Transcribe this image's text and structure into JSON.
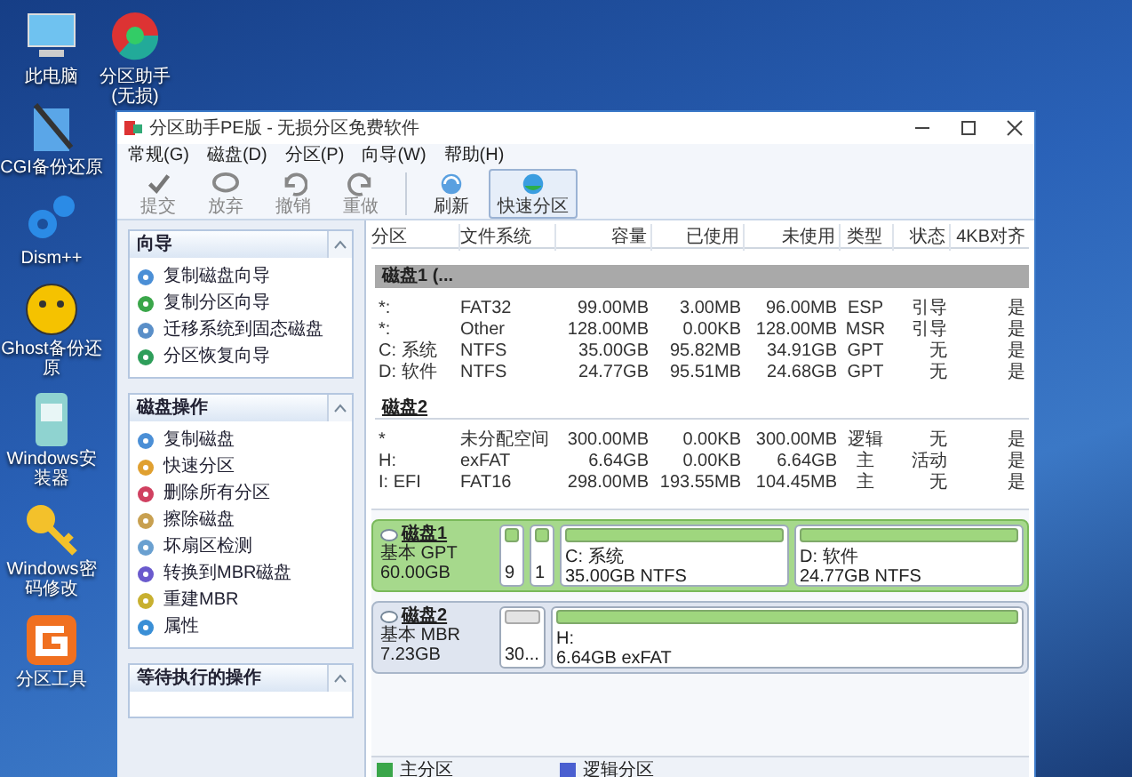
{
  "desktop_icons": [
    {
      "label": "此电脑",
      "kind": "computer"
    },
    {
      "label": "CGI备份还原",
      "kind": "tools"
    },
    {
      "label": "Dism++",
      "kind": "gears"
    },
    {
      "label": "Ghost备份还原",
      "kind": "ghost"
    },
    {
      "label": "Windows安装器",
      "kind": "installer"
    },
    {
      "label": "Windows密码修改",
      "kind": "key"
    },
    {
      "label": "分区工具",
      "kind": "diskgenius"
    }
  ],
  "desktop_icon_extra": {
    "label": "分区助手(无损)",
    "kind": "pie"
  },
  "window": {
    "title": "分区助手PE版 - 无损分区免费软件"
  },
  "menu": [
    "常规(G)",
    "磁盘(D)",
    "分区(P)",
    "向导(W)",
    "帮助(H)"
  ],
  "toolbar": [
    {
      "label": "提交",
      "kind": "check",
      "disabled": true,
      "selected": false
    },
    {
      "label": "放弃",
      "kind": "discard",
      "disabled": true,
      "selected": false
    },
    {
      "label": "撤销",
      "kind": "undo",
      "disabled": true,
      "selected": false
    },
    {
      "label": "重做",
      "kind": "redo",
      "disabled": true,
      "selected": false
    },
    {
      "label": "刷新",
      "kind": "refresh",
      "disabled": false,
      "selected": false
    },
    {
      "label": "快速分区",
      "kind": "quick",
      "disabled": false,
      "selected": true
    }
  ],
  "sidebar": [
    {
      "title": "向导",
      "items": [
        {
          "label": "复制磁盘向导",
          "kind": "disk"
        },
        {
          "label": "复制分区向导",
          "kind": "partition"
        },
        {
          "label": "迁移系统到固态磁盘",
          "kind": "migrate"
        },
        {
          "label": "分区恢复向导",
          "kind": "recover"
        }
      ]
    },
    {
      "title": "磁盘操作",
      "items": [
        {
          "label": "复制磁盘",
          "kind": "disk"
        },
        {
          "label": "快速分区",
          "kind": "quick"
        },
        {
          "label": "删除所有分区",
          "kind": "delete"
        },
        {
          "label": "擦除磁盘",
          "kind": "wipe"
        },
        {
          "label": "坏扇区检测",
          "kind": "scan"
        },
        {
          "label": "转换到MBR磁盘",
          "kind": "convert"
        },
        {
          "label": "重建MBR",
          "kind": "rebuild"
        },
        {
          "label": "属性",
          "kind": "info"
        }
      ]
    },
    {
      "title": "等待执行的操作"
    }
  ],
  "table": {
    "columns": [
      "分区",
      "文件系统",
      "容量",
      "已使用",
      "未使用",
      "类型",
      "状态",
      "4KB对齐"
    ],
    "disks": [
      {
        "header": "磁盘1 (...",
        "selected": true,
        "rows": [
          [
            "*:",
            "FAT32",
            "99.00MB",
            "3.00MB",
            "96.00MB",
            "ESP",
            "引导",
            "是"
          ],
          [
            "*:",
            "Other",
            "128.00MB",
            "0.00KB",
            "128.00MB",
            "MSR",
            "引导",
            "是"
          ],
          [
            "C: 系统",
            "NTFS",
            "35.00GB",
            "95.82MB",
            "34.91GB",
            "GPT",
            "无",
            "是"
          ],
          [
            "D: 软件",
            "NTFS",
            "24.77GB",
            "95.51MB",
            "24.68GB",
            "GPT",
            "无",
            "是"
          ]
        ]
      },
      {
        "header": "磁盘2",
        "selected": false,
        "rows": [
          [
            "*",
            "未分配空间",
            "300.00MB",
            "0.00KB",
            "300.00MB",
            "逻辑",
            "无",
            "是"
          ],
          [
            "H:",
            "exFAT",
            "6.64GB",
            "0.00KB",
            "6.64GB",
            "主",
            "活动",
            "是"
          ],
          [
            "I: EFI",
            "FAT16",
            "298.00MB",
            "193.55MB",
            "104.45MB",
            "主",
            "无",
            "是"
          ]
        ]
      }
    ]
  },
  "disk_map": [
    {
      "name": "磁盘1",
      "type": "基本 GPT",
      "size": "60.00GB",
      "selected": true,
      "partitions": [
        {
          "kind": "small",
          "label": "9"
        },
        {
          "kind": "small",
          "label": "1"
        },
        {
          "kind": "primary",
          "label": "C: 系统",
          "detail": "35.00GB NTFS"
        },
        {
          "kind": "primary",
          "label": "D: 软件",
          "detail": "24.77GB NTFS"
        }
      ]
    },
    {
      "name": "磁盘2",
      "type": "基本 MBR",
      "size": "7.23GB",
      "selected": false,
      "partitions": [
        {
          "kind": "unallocated",
          "label": "30..."
        },
        {
          "kind": "primary",
          "label": "H:",
          "detail": "6.64GB exFAT"
        }
      ]
    }
  ],
  "legend": [
    {
      "label": "主分区",
      "color": "#3aa64a"
    },
    {
      "label": "逻辑分区",
      "color": "#4a5fd0"
    }
  ]
}
